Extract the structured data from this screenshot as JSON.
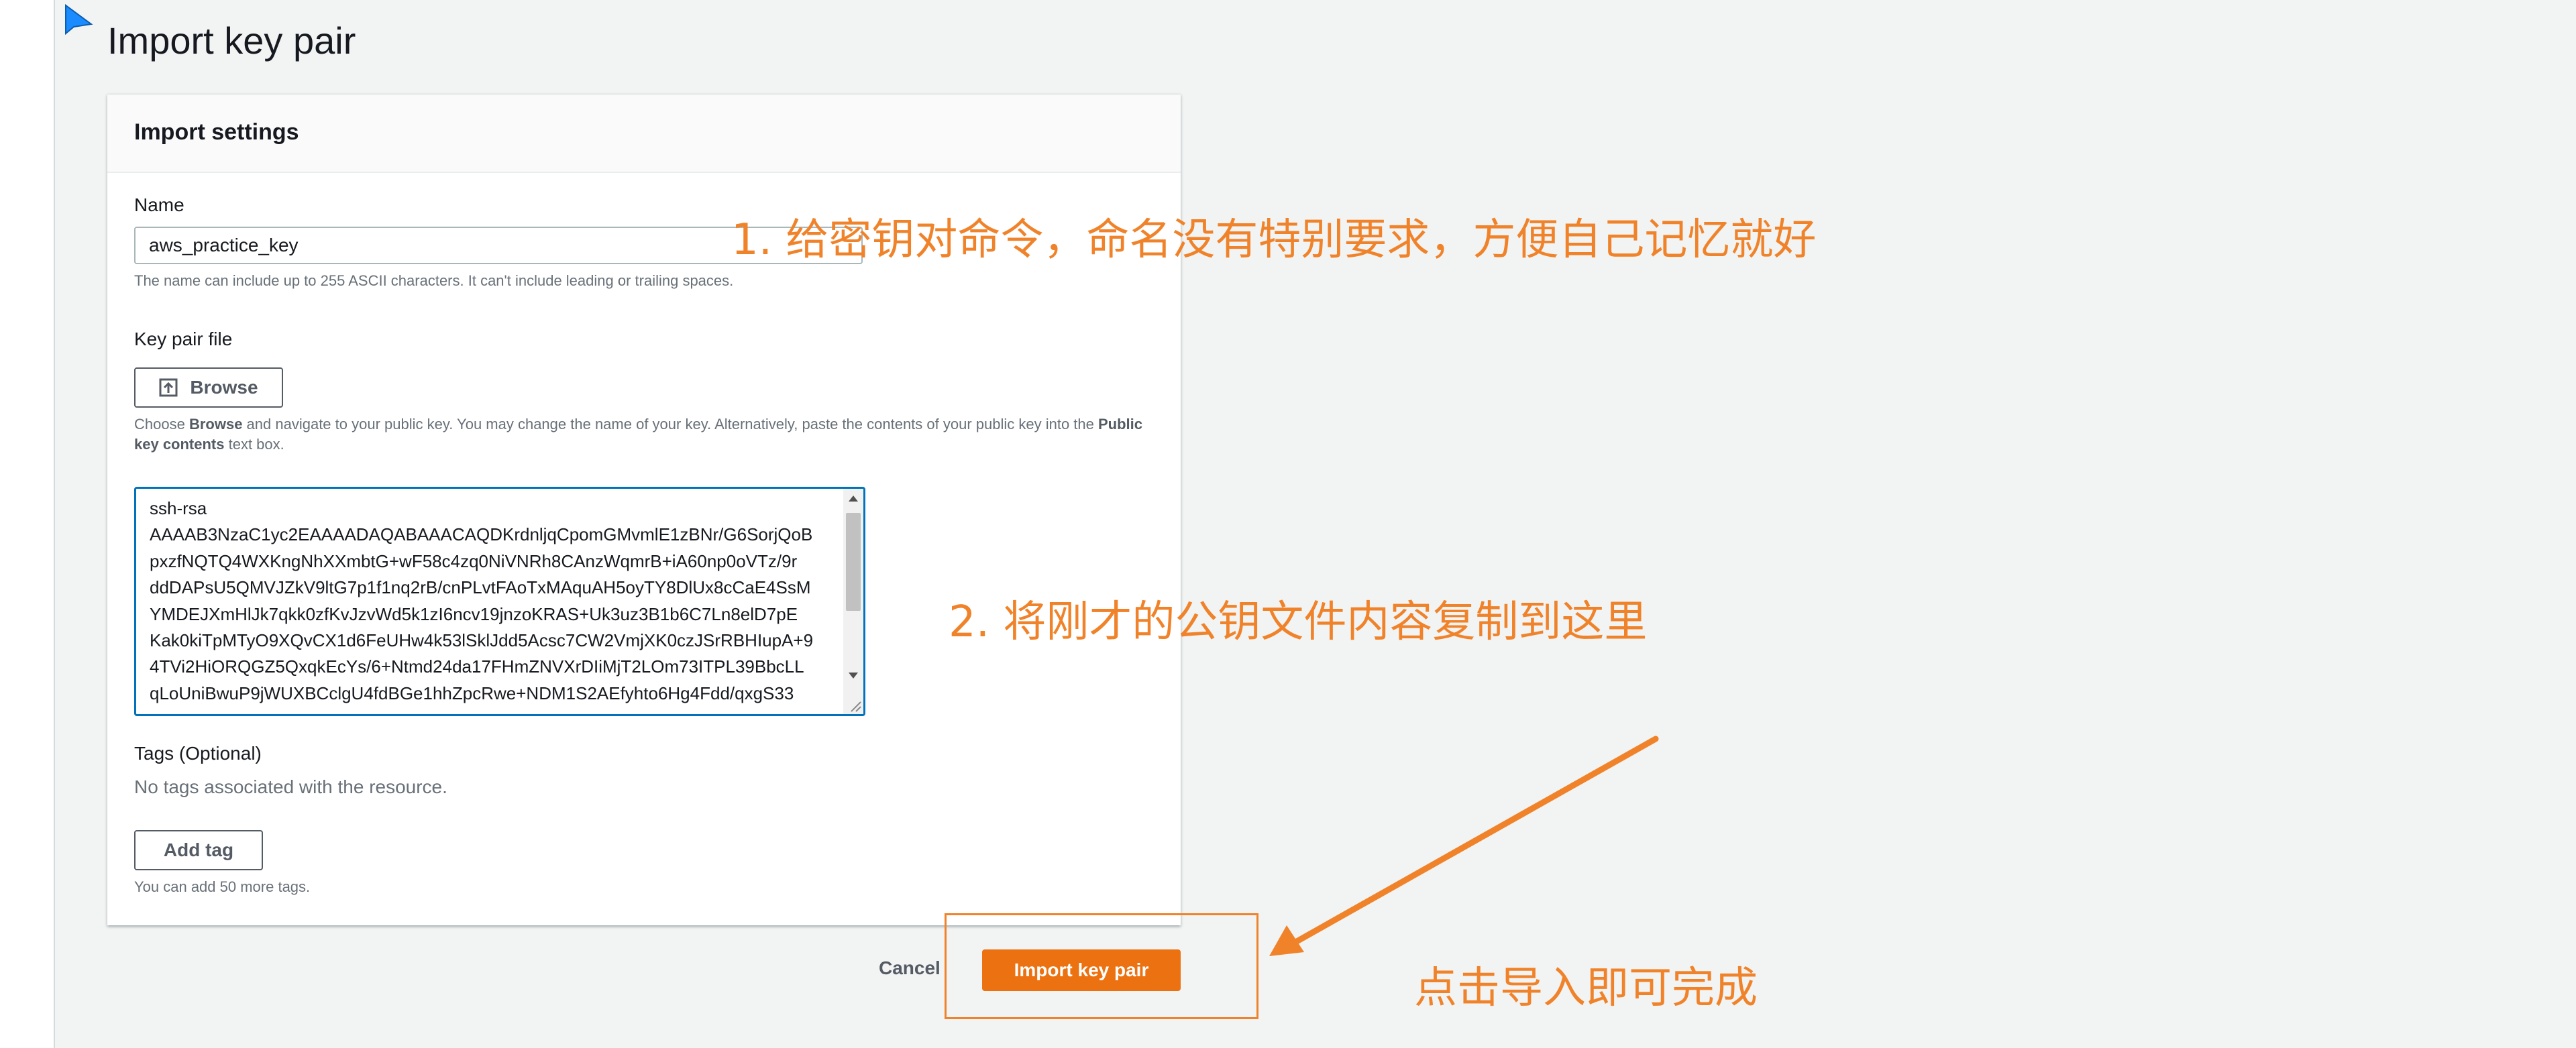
{
  "page": {
    "title": "Import key pair"
  },
  "settings": {
    "title": "Import settings",
    "name_label": "Name",
    "name_value": "aws_practice_key",
    "name_hint": "The name can include up to 255 ASCII characters. It can't include leading or trailing spaces.",
    "key_file_label": "Key pair file",
    "browse_label": "Browse",
    "browse_hint_1": "Choose ",
    "browse_hint_bold_1": "Browse",
    "browse_hint_2": " and navigate to your public key. You may change the name of your key. Alternatively, paste the contents of your public key into the ",
    "browse_hint_bold_2": "Public key contents",
    "browse_hint_3": " text box.",
    "public_key_lines": [
      "ssh-rsa",
      "AAAAB3NzaC1yc2EAAAADAQABAAACAQDKrdnljqCpomGMvmlE1zBNr/G6SorjQoB",
      "pxzfNQTQ4WXKngNhXXmbtG+wF58c4zq0NiVNRh8CAnzWqmrB+iA60np0oVTz/9r",
      "ddDAPsU5QMVJZkV9ltG7p1f1nq2rB/cnPLvtFAoTxMAquAH5oyTY8DlUx8cCaE4SsM",
      "YMDEJXmHlJk7qkk0zfKvJzvWd5k1zI6ncv19jnzoKRAS+Uk3uz3B1b6C7Ln8elD7pE",
      "Kak0kiTpMTyO9XQvCX1d6FeUHw4k53lSklJdd5Acsc7CW2VmjXK0czJSrRBHIupA+9",
      "4TVi2HiORQGZ5QxqkEcYs/6+Ntmd24da17FHmZNVXrDIiMjT2LOm73ITPL39BbcLL",
      "qLoUniBwuP9jWUXBCclgU4fdBGe1hhZpcRwe+NDM1S2AEfyhto6Hg4Fdd/qxgS33"
    ],
    "tags_label": "Tags (Optional)",
    "tags_empty": "No tags associated with the resource.",
    "add_tag_label": "Add tag",
    "tags_hint": "You can add 50 more tags."
  },
  "footer": {
    "cancel_label": "Cancel",
    "import_label": "Import key pair"
  },
  "annotations": {
    "step1": "1. 给密钥对命令，命名没有特别要求，方便自己记忆就好",
    "step2": "2. 将刚才的公钥文件内容复制到这里",
    "step3": "点击导入即可完成",
    "color": "#f0832a"
  },
  "colors": {
    "primary": "#ec7211",
    "focus": "#0073bb",
    "background": "#f2f3f3"
  }
}
